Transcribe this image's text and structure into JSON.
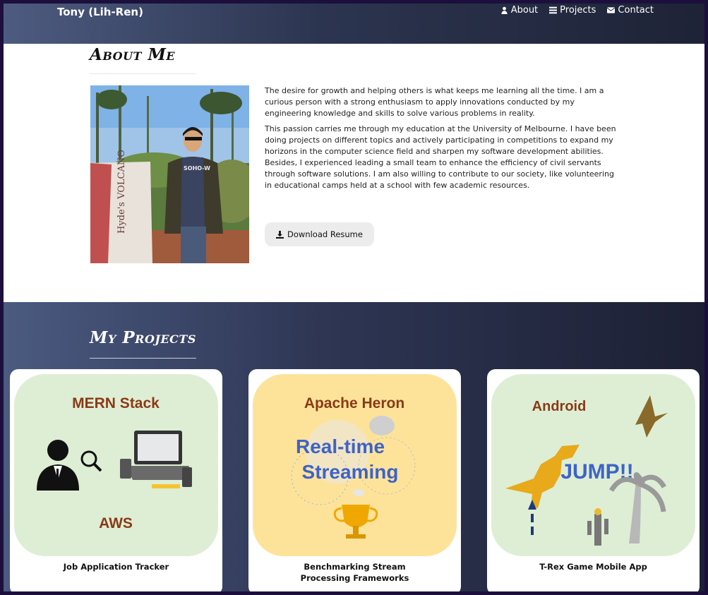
{
  "nav": {
    "brand": "Tony (Lih-Ren)",
    "links": [
      {
        "label": "About",
        "icon": "user-icon"
      },
      {
        "label": "Projects",
        "icon": "list-icon"
      },
      {
        "label": "Contact",
        "icon": "envelope-icon"
      }
    ]
  },
  "about": {
    "title": "About Me",
    "photo_text": "Hyde's VOLCANO",
    "shirt_text": "SOHO-W",
    "paragraphs": [
      "The desire for growth and helping others is what keeps me learning all the time. I am a curious person with a strong enthusiasm to apply innovations conducted by my engineering knowledge and skills to solve various problems in reality.",
      "This passion carries me through my education at the University of Melbourne. I have been doing projects on different topics and actively participating in competitions to expand my horizons in the computer science field and sharpen my software development abilities. Besides, I experienced leading a small team to enhance the efficiency of civil servants through software solutions. I am also willing to contribute to our society, like volunteering in educational camps held at a school with few academic resources."
    ],
    "resume_button": "Download Resume"
  },
  "projects": {
    "title": "My Projects",
    "items": [
      {
        "caption": "Job Application Tracker",
        "thumb_top": "MERN Stack",
        "thumb_bottom": "AWS",
        "bg": "#deeed5"
      },
      {
        "caption": "Benchmarking Stream Processing Frameworks",
        "thumb_top": "Apache Heron",
        "thumb_line1": "Real-time",
        "thumb_line2": "Streaming",
        "bg": "#fde39a"
      },
      {
        "caption": "T-Rex Game Mobile App",
        "thumb_top": "Android",
        "thumb_mid": "JUMP!!",
        "bg": "#deeed5"
      }
    ]
  },
  "colors": {
    "thumb_brown": "#8a3a16",
    "thumb_blue": "#3d63c8",
    "nav_gradient_start": "#4d5b80",
    "nav_gradient_end": "#1e2336"
  }
}
